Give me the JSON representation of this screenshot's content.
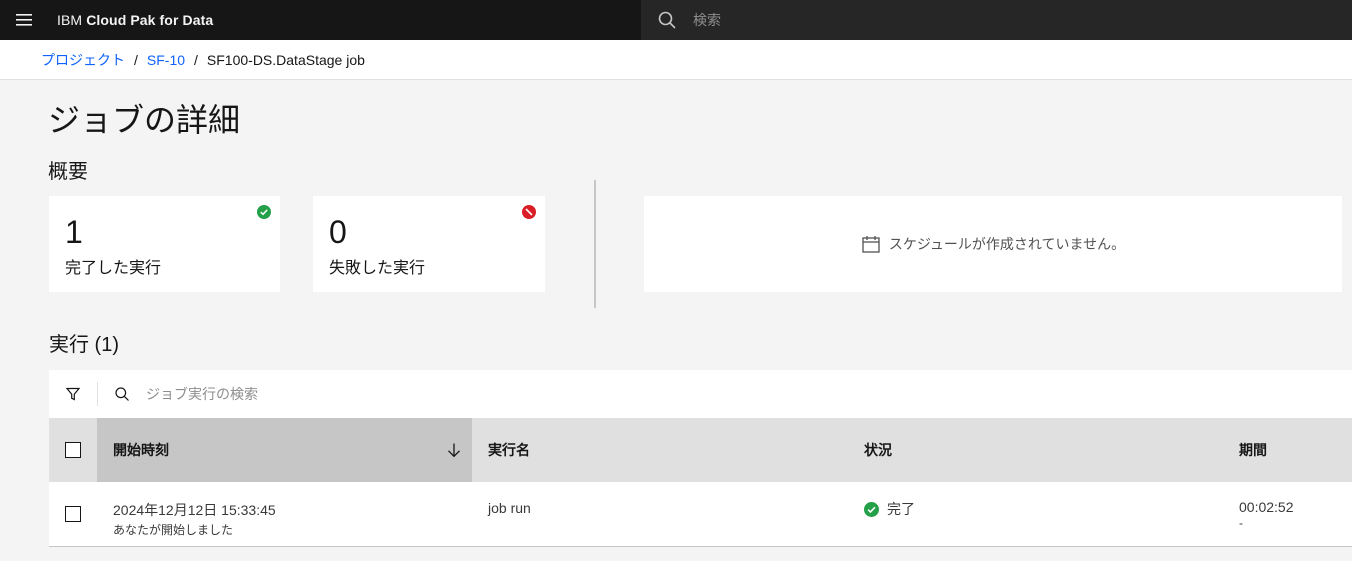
{
  "header": {
    "brand_prefix": "IBM",
    "brand_name": "Cloud Pak for Data",
    "search_placeholder": "検索"
  },
  "breadcrumb": {
    "items": [
      "プロジェクト",
      "SF-10"
    ],
    "current": "SF100-DS.DataStage job",
    "separator": "/"
  },
  "page": {
    "title": "ジョブの詳細",
    "overview_title": "概要"
  },
  "summary": {
    "completed": {
      "count": "1",
      "label": "完了した実行",
      "status_color": "#24a148"
    },
    "failed": {
      "count": "0",
      "label": "失敗した実行",
      "status_color": "#da1e28"
    },
    "schedule_text": "スケジュールが作成されていません。"
  },
  "runs": {
    "title": "実行 (1)",
    "search_placeholder": "ジョブ実行の検索",
    "columns": [
      "開始時刻",
      "実行名",
      "状況",
      "期間"
    ],
    "rows": [
      {
        "start_time": "2024年12月12日 15:33:45",
        "started_by": "あなたが開始しました",
        "name": "job run",
        "status": "完了",
        "duration": "00:02:52",
        "duration_sub": "-"
      }
    ]
  },
  "colors": {
    "header_bg": "#161616",
    "link": "#0f62fe",
    "success": "#24a148",
    "error": "#da1e28"
  }
}
